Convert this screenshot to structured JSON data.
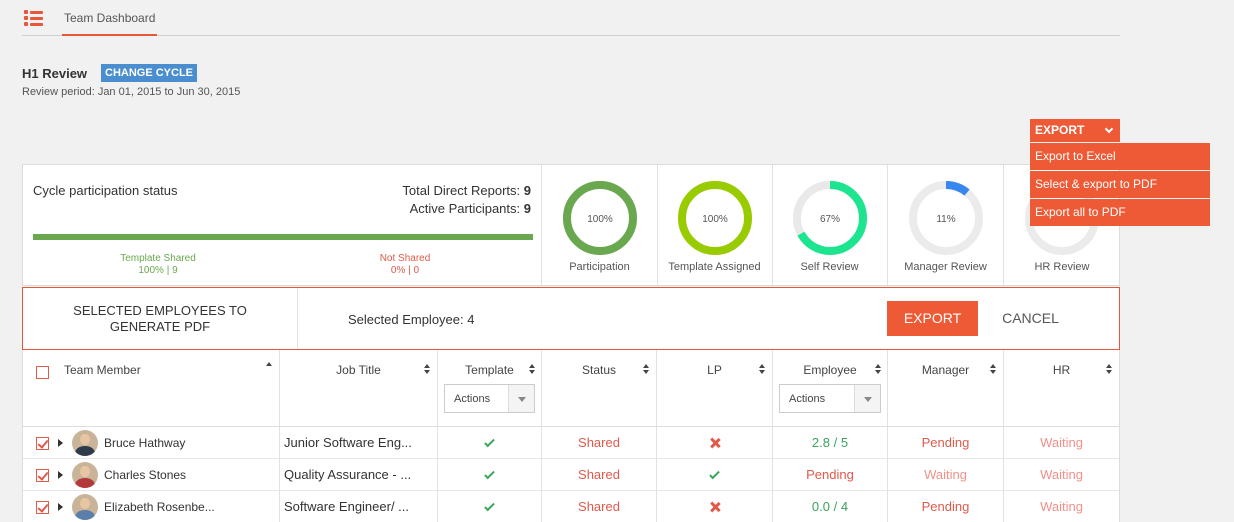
{
  "nav": {
    "tab": "Team Dashboard"
  },
  "review": {
    "title": "H1 Review",
    "change_cycle": "CHANGE CYCLE",
    "period": "Review period: Jan 01, 2015 to Jun 30, 2015"
  },
  "export": {
    "label": "EXPORT",
    "menu": [
      "Export to Excel",
      "Select & export to PDF",
      "Export all to PDF"
    ]
  },
  "stats": {
    "label": "Cycle participation status",
    "total_direct_label": "Total Direct Reports:",
    "total_direct_value": "9",
    "active_label": "Active Participants:",
    "active_value": "9",
    "shared_label": "Template Shared",
    "shared_value": "100% | 9",
    "notshared_label": "Not Shared",
    "notshared_value": "0% | 0",
    "shared_fraction": 1.0,
    "donuts": [
      {
        "label": "Participation",
        "pct_text": "100%",
        "value": 100,
        "color": "#6aa84f",
        "track": "#e6e6e6"
      },
      {
        "label": "Template Assigned",
        "pct_text": "100%",
        "value": 100,
        "color": "#99cc00",
        "track": "#e6e6e6"
      },
      {
        "label": "Self Review",
        "pct_text": "67%",
        "value": 67,
        "color": "#1de58f",
        "track": "#e9e9e9"
      },
      {
        "label": "Manager Review",
        "pct_text": "11%",
        "value": 11,
        "color": "#3a86f0",
        "track": "#ebebeb"
      },
      {
        "label": "HR Review",
        "pct_text": "0%",
        "value": 0,
        "color": "#cccccc",
        "track": "#ebebeb"
      }
    ]
  },
  "selection": {
    "title_line1": "SELECTED EMPLOYEES TO",
    "title_line2": "GENERATE PDF",
    "count_text": "Selected Employee: 4",
    "export": "EXPORT",
    "cancel": "CANCEL"
  },
  "table": {
    "headers": {
      "member": "Team Member",
      "job": "Job Title",
      "template": "Template",
      "status": "Status",
      "lp": "LP",
      "employee": "Employee",
      "manager": "Manager",
      "hr": "HR"
    },
    "actions_label": "Actions",
    "rows": [
      {
        "name": "Bruce Hathway",
        "job": "Junior Software Eng...",
        "template": "check-icon",
        "status": "Shared",
        "lp": "cross-icon",
        "employee": "2.8 / 5",
        "employee_tone": "green",
        "manager": "Pending",
        "hr": "Waiting",
        "avatar_color": "#2f3b4a"
      },
      {
        "name": "Charles Stones",
        "job": "Quality Assurance - ...",
        "template": "check-icon",
        "status": "Shared",
        "lp": "check-icon",
        "employee": "Pending",
        "employee_tone": "red",
        "manager": "Waiting",
        "hr": "Waiting",
        "avatar_color": "#b23a3a"
      },
      {
        "name": "Elizabeth Rosenbe...",
        "job": "Software Engineer/ ...",
        "template": "check-icon",
        "status": "Shared",
        "lp": "cross-icon",
        "employee": "0.0 / 4",
        "employee_tone": "green",
        "manager": "Pending",
        "hr": "Waiting",
        "avatar_color": "#5a7fa8"
      }
    ]
  }
}
